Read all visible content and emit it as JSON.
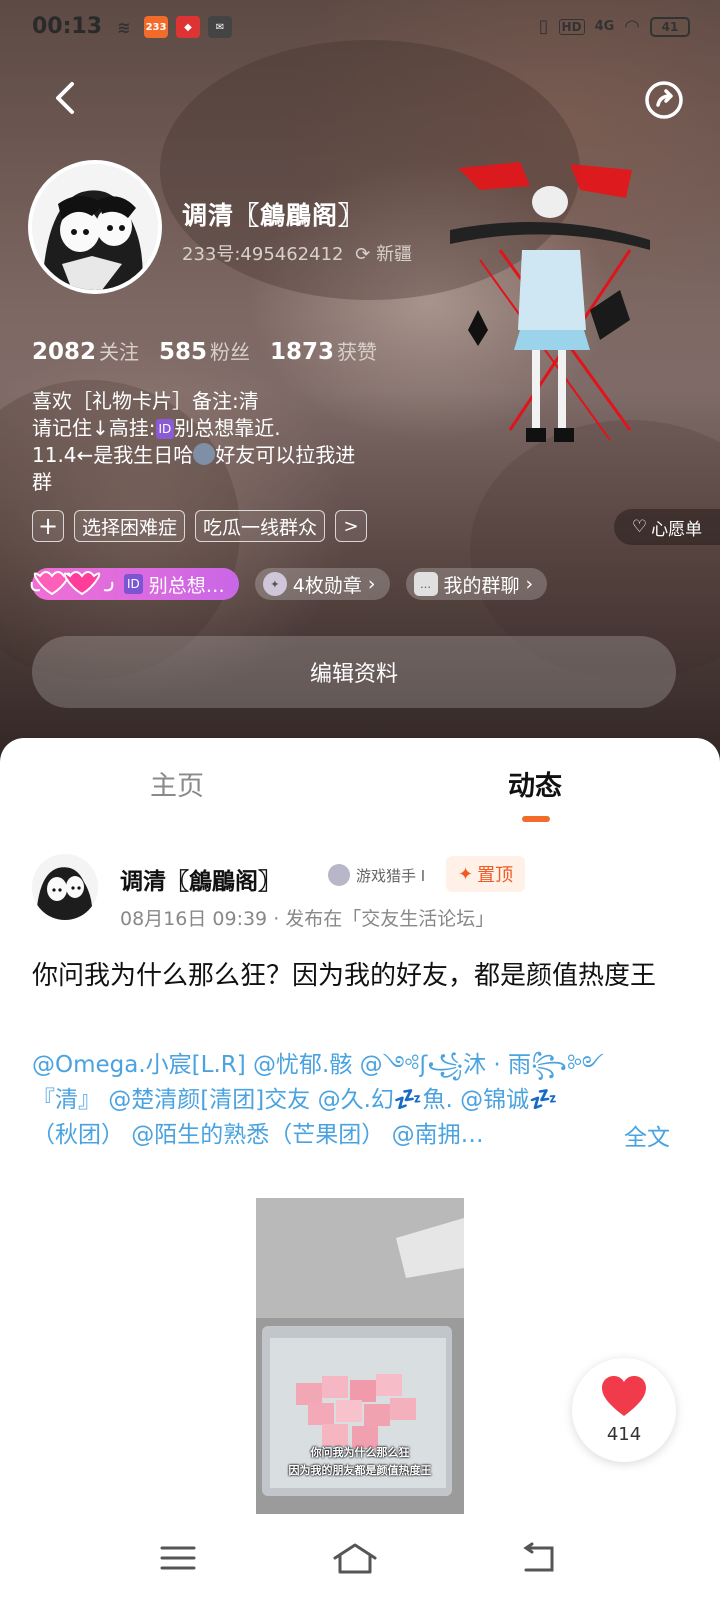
{
  "status_bar": {
    "time": "00:13",
    "battery": "41",
    "network": "4G",
    "hd": "HD",
    "app_badge": "233"
  },
  "profile": {
    "name": "调清〖鶬鶥阁〗",
    "uid": "233号:495462412",
    "location": "新疆",
    "stats": [
      {
        "num": "2082",
        "label": "关注"
      },
      {
        "num": "585",
        "label": "粉丝"
      },
      {
        "num": "1873",
        "label": "获赞"
      }
    ],
    "bio_lines": [
      "喜欢［礼物卡片］备注:清",
      "请记住↓高挂:",
      "别总想靠近.",
      "11.4←是我生日哈",
      "好友可以拉我进",
      "群"
    ],
    "id_badge": "ID",
    "tags": [
      "+",
      "选择困难症",
      "吃瓜一线群众",
      ">"
    ],
    "wishlist": "心愿单",
    "chips": {
      "pink": "别总想…",
      "pink_badge": "ID",
      "medals": "4枚勋章",
      "groups": "我的群聊"
    },
    "edit_button": "编辑资料"
  },
  "tabs": {
    "home": "主页",
    "feed": "动态"
  },
  "post": {
    "author": "调清〖鶬鶥阁〗",
    "badge": "游戏猎手 I",
    "pinned": "置顶",
    "meta": "08月16日 09:39 · 发布在「交友生活论坛」",
    "title": "你问我为什么那么狂？因为我的好友，都是颜值热度王",
    "mention_lines": [
      "@Omega.小宸[L.R]  @忧郁.骸  @༺ʃ꧁沐 · 雨꧂༻",
      "『清』 @楚清颜[清团]交友  @久.幻💤魚.  @锦诚💤",
      "（秋团）  @陌生的熟悉（芒果团）  @南拥…"
    ],
    "more": "全文",
    "image_caption_1": "你问我为什么那么狂",
    "image_caption_2": "因为我的朋友都是颜值热度王",
    "likes": "414"
  },
  "colors": {
    "accent": "#f26b2a",
    "link": "#4aa3e0",
    "pin_bg": "#fff1e8",
    "pink_chip": "#f06fd6"
  },
  "icons": [
    "back-icon",
    "share-icon",
    "heart-icon",
    "menu-icon",
    "home-icon",
    "return-icon"
  ]
}
